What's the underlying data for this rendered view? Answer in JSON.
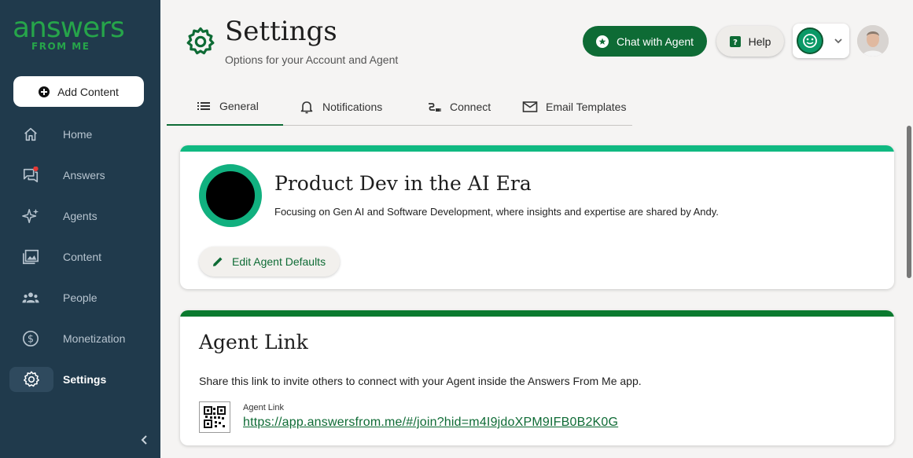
{
  "brand": {
    "logo_main": "answers",
    "logo_sub": "FROM ME",
    "primary_color": "#0e6b35",
    "accent_color": "#10b981",
    "sidebar_color": "#203a4c"
  },
  "sidebar": {
    "add_content_label": "Add Content",
    "items": [
      {
        "label": "Home",
        "icon": "home-icon"
      },
      {
        "label": "Answers",
        "icon": "chat-icon",
        "badge": true
      },
      {
        "label": "Agents",
        "icon": "sparkle-icon"
      },
      {
        "label": "Content",
        "icon": "images-icon"
      },
      {
        "label": "People",
        "icon": "people-icon"
      },
      {
        "label": "Monetization",
        "icon": "dollar-icon"
      },
      {
        "label": "Settings",
        "icon": "gear-icon",
        "active": true
      }
    ],
    "collapse_icon": "chevron-left-icon"
  },
  "header": {
    "title": "Settings",
    "subtitle": "Options for your Account and Agent",
    "chat_button": "Chat with Agent",
    "help_button": "Help"
  },
  "tabs": [
    {
      "label": "General",
      "icon": "list-icon",
      "active": true
    },
    {
      "label": "Notifications",
      "icon": "bell-icon"
    },
    {
      "label": "Connect",
      "icon": "connect-icon"
    },
    {
      "label": "Email Templates",
      "icon": "mail-icon"
    }
  ],
  "agent_card": {
    "name": "Product Dev in the AI Era",
    "description": "Focusing on Gen AI and Software Development, where insights and expertise are shared by Andy.",
    "edit_button": "Edit Agent Defaults"
  },
  "link_card": {
    "title": "Agent Link",
    "description": "Share this link to invite others to connect with your Agent inside the Answers From Me app.",
    "link_label": "Agent Link",
    "link_url": "https://app.answersfrom.me/#/join?hid=m4I9jdoXPM9IFB0B2K0G"
  }
}
